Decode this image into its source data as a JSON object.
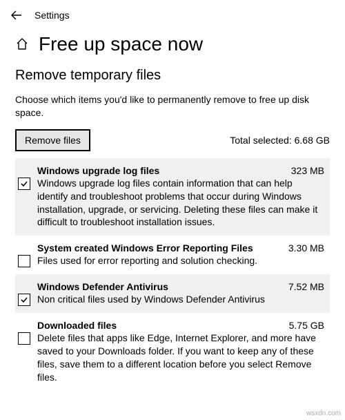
{
  "header": {
    "app_title": "Settings"
  },
  "page": {
    "title": "Free up space now"
  },
  "section": {
    "title": "Remove temporary files",
    "description": "Choose which items you'd like to permanently remove to free up disk space."
  },
  "action": {
    "remove_label": "Remove files",
    "total_label": "Total selected: 6.68 GB"
  },
  "items": [
    {
      "title": "Windows upgrade log files",
      "size": "323 MB",
      "description": "Windows upgrade log files contain information that can help identify and troubleshoot problems that occur during Windows installation, upgrade, or servicing.  Deleting these files can make it difficult to troubleshoot installation issues.",
      "checked": true
    },
    {
      "title": "System created Windows Error Reporting Files",
      "size": "3.30 MB",
      "description": "Files used for error reporting and solution checking.",
      "checked": false
    },
    {
      "title": "Windows Defender Antivirus",
      "size": "7.52 MB",
      "description": "Non critical files used by Windows Defender Antivirus",
      "checked": true
    },
    {
      "title": "Downloaded files",
      "size": "5.75 GB",
      "description": "Delete files that apps like Edge, Internet Explorer, and more have saved to your Downloads folder. If you want to keep any of these files, save them to a different location before you select Remove files.",
      "checked": false
    }
  ],
  "watermark": "wsxdn.com"
}
